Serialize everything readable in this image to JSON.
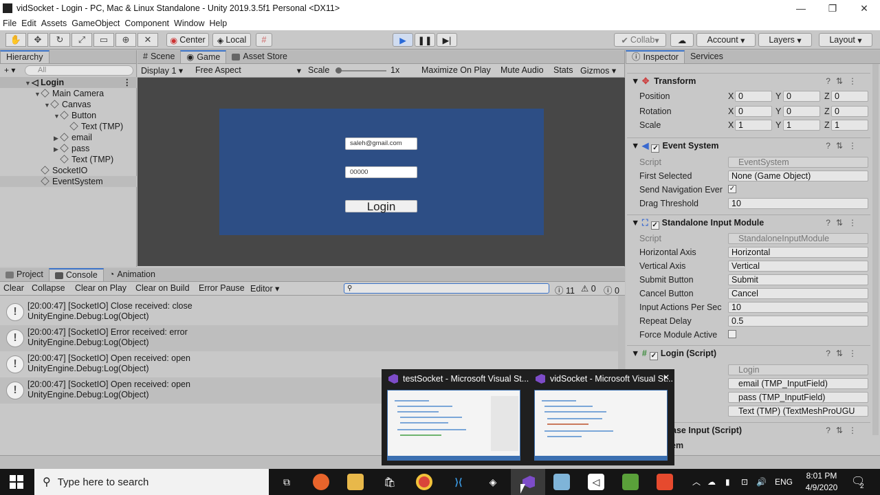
{
  "window": {
    "title": "vidSocket - Login - PC, Mac & Linux Standalone - Unity 2019.3.5f1 Personal <DX11>"
  },
  "menu": [
    "File",
    "Edit",
    "Assets",
    "GameObject",
    "Component",
    "Window",
    "Help"
  ],
  "toolbar": {
    "center": "Center",
    "local": "Local",
    "collab": "Collab",
    "account": "Account",
    "layers": "Layers",
    "layout": "Layout"
  },
  "hierarchy": {
    "tab": "Hierarchy",
    "search_placeholder": "All",
    "items": [
      {
        "label": "Login",
        "bold": true
      },
      {
        "label": "Main Camera"
      },
      {
        "label": "Canvas"
      },
      {
        "label": "Button"
      },
      {
        "label": "Text (TMP)"
      },
      {
        "label": "email"
      },
      {
        "label": "pass"
      },
      {
        "label": "Text (TMP)"
      },
      {
        "label": "SocketIO"
      },
      {
        "label": "EventSystem"
      }
    ]
  },
  "game": {
    "tabs": [
      "Scene",
      "Game",
      "Asset Store"
    ],
    "display": "Display 1",
    "aspect": "Free Aspect",
    "scale_label": "Scale",
    "scale_value": "1x",
    "options": [
      "Maximize On Play",
      "Mute Audio",
      "Stats",
      "Gizmos"
    ],
    "email_value": "saleh@gmail.com",
    "pass_value": "00000",
    "login_label": "Login"
  },
  "console": {
    "tabs": [
      "Project",
      "Console",
      "Animation"
    ],
    "buttons": [
      "Clear",
      "Collapse",
      "Clear on Play",
      "Clear on Build",
      "Error Pause",
      "Editor"
    ],
    "counts": {
      "log": "11",
      "warn": "0",
      "error": "0"
    },
    "entries": [
      {
        "line1": "[20:00:47] [SocketIO] Close received: close",
        "line2": "UnityEngine.Debug:Log(Object)"
      },
      {
        "line1": "[20:00:47] [SocketIO] Error received: error",
        "line2": "UnityEngine.Debug:Log(Object)"
      },
      {
        "line1": "[20:00:47] [SocketIO] Open received: open",
        "line2": "UnityEngine.Debug:Log(Object)"
      },
      {
        "line1": "[20:00:47] [SocketIO] Open received: open",
        "line2": "UnityEngine.Debug:Log(Object)"
      }
    ]
  },
  "inspector": {
    "tabs": [
      "Inspector",
      "Services"
    ],
    "transform": {
      "title": "Transform",
      "position": [
        "0",
        "0",
        "0"
      ],
      "rotation": [
        "0",
        "0",
        "0"
      ],
      "scale": [
        "1",
        "1",
        "1"
      ],
      "labels": [
        "Position",
        "Rotation",
        "Scale"
      ]
    },
    "event_system": {
      "title": "Event System",
      "script_label": "Script",
      "script": "EventSystem",
      "first_selected_label": "First Selected",
      "first_selected": "None (Game Object)",
      "send_nav_label": "Send Navigation Ever",
      "drag_label": "Drag Threshold",
      "drag": "10"
    },
    "input_module": {
      "title": "Standalone Input Module",
      "script_label": "Script",
      "script": "StandaloneInputModule",
      "rows": [
        {
          "label": "Horizontal Axis",
          "value": "Horizontal"
        },
        {
          "label": "Vertical Axis",
          "value": "Vertical"
        },
        {
          "label": "Submit Button",
          "value": "Submit"
        },
        {
          "label": "Cancel Button",
          "value": "Cancel"
        },
        {
          "label": "Input Actions Per Sec",
          "value": "10"
        },
        {
          "label": "Repeat Delay",
          "value": "0.5"
        }
      ],
      "force_label": "Force Module Active"
    },
    "login_script": {
      "title": "Login (Script)",
      "script": "Login",
      "refs": [
        "email (TMP_InputField)",
        "pass (TMP_InputField)",
        "Text (TMP) (TextMeshProUGU"
      ]
    },
    "partial": {
      "header": "ase Input (Script)",
      "row": "em"
    }
  },
  "popup": {
    "left_title": "testSocket - Microsoft Visual St...",
    "right_title": "vidSocket - Microsoft Visual St..."
  },
  "taskbar": {
    "search_placeholder": "Type here to search",
    "lang": "ENG",
    "time": "8:01 PM",
    "date": "4/9/2020",
    "notif_count": "2"
  }
}
